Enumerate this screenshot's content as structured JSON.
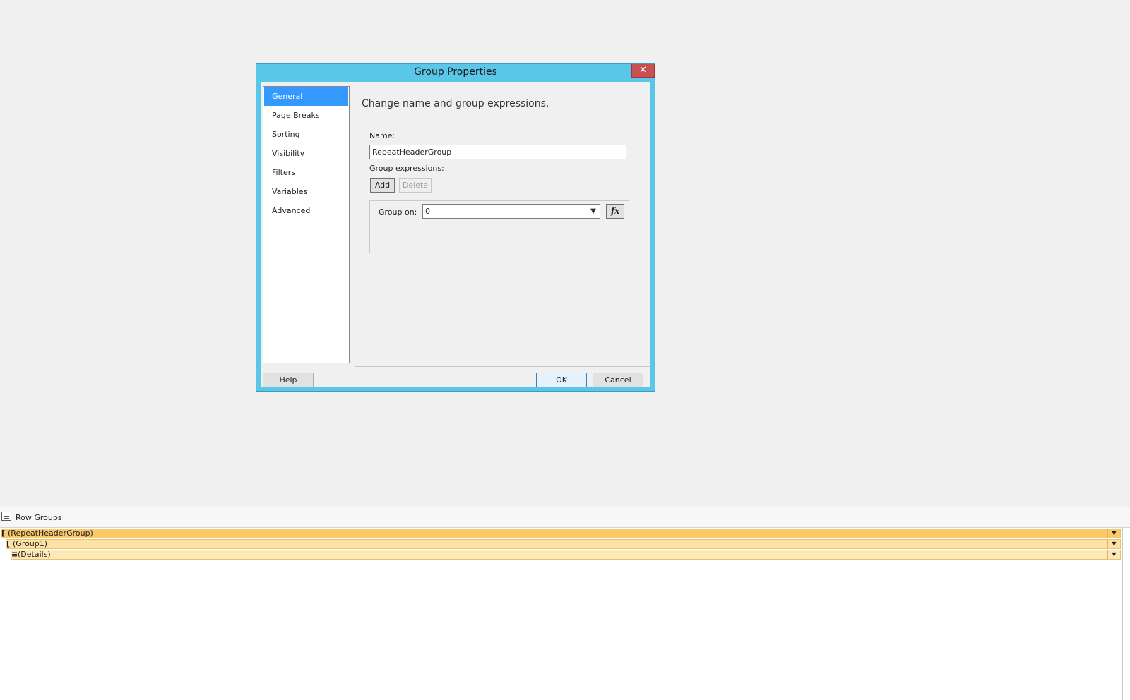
{
  "dialog": {
    "title": "Group Properties",
    "close_glyph": "✕",
    "nav_items": [
      {
        "label": "General",
        "selected": true
      },
      {
        "label": "Page Breaks",
        "selected": false
      },
      {
        "label": "Sorting",
        "selected": false
      },
      {
        "label": "Visibility",
        "selected": false
      },
      {
        "label": "Filters",
        "selected": false
      },
      {
        "label": "Variables",
        "selected": false
      },
      {
        "label": "Advanced",
        "selected": false
      }
    ],
    "heading": "Change name and group expressions.",
    "name_label": "Name:",
    "name_value": "RepeatHeaderGroup",
    "group_expressions_label": "Group expressions:",
    "add_label": "Add",
    "delete_label": "Delete",
    "group_on_label": "Group on:",
    "group_on_value": "0",
    "fx_label": "fx",
    "help_label": "Help",
    "ok_label": "OK",
    "cancel_label": "Cancel"
  },
  "row_groups": {
    "title": "Row Groups",
    "items": [
      {
        "label": "(RepeatHeaderGroup)",
        "bracket": "[",
        "color": "#f9c96a"
      },
      {
        "label": "(Group1)",
        "bracket": "[",
        "color": "#fde2a4"
      },
      {
        "label": "(Details)",
        "bracket": "≡",
        "color": "#fde9b8"
      }
    ]
  },
  "colors": {
    "dialog_frame": "#5bc7e8",
    "close_button": "#c75050",
    "selected_nav": "#3399ff"
  }
}
